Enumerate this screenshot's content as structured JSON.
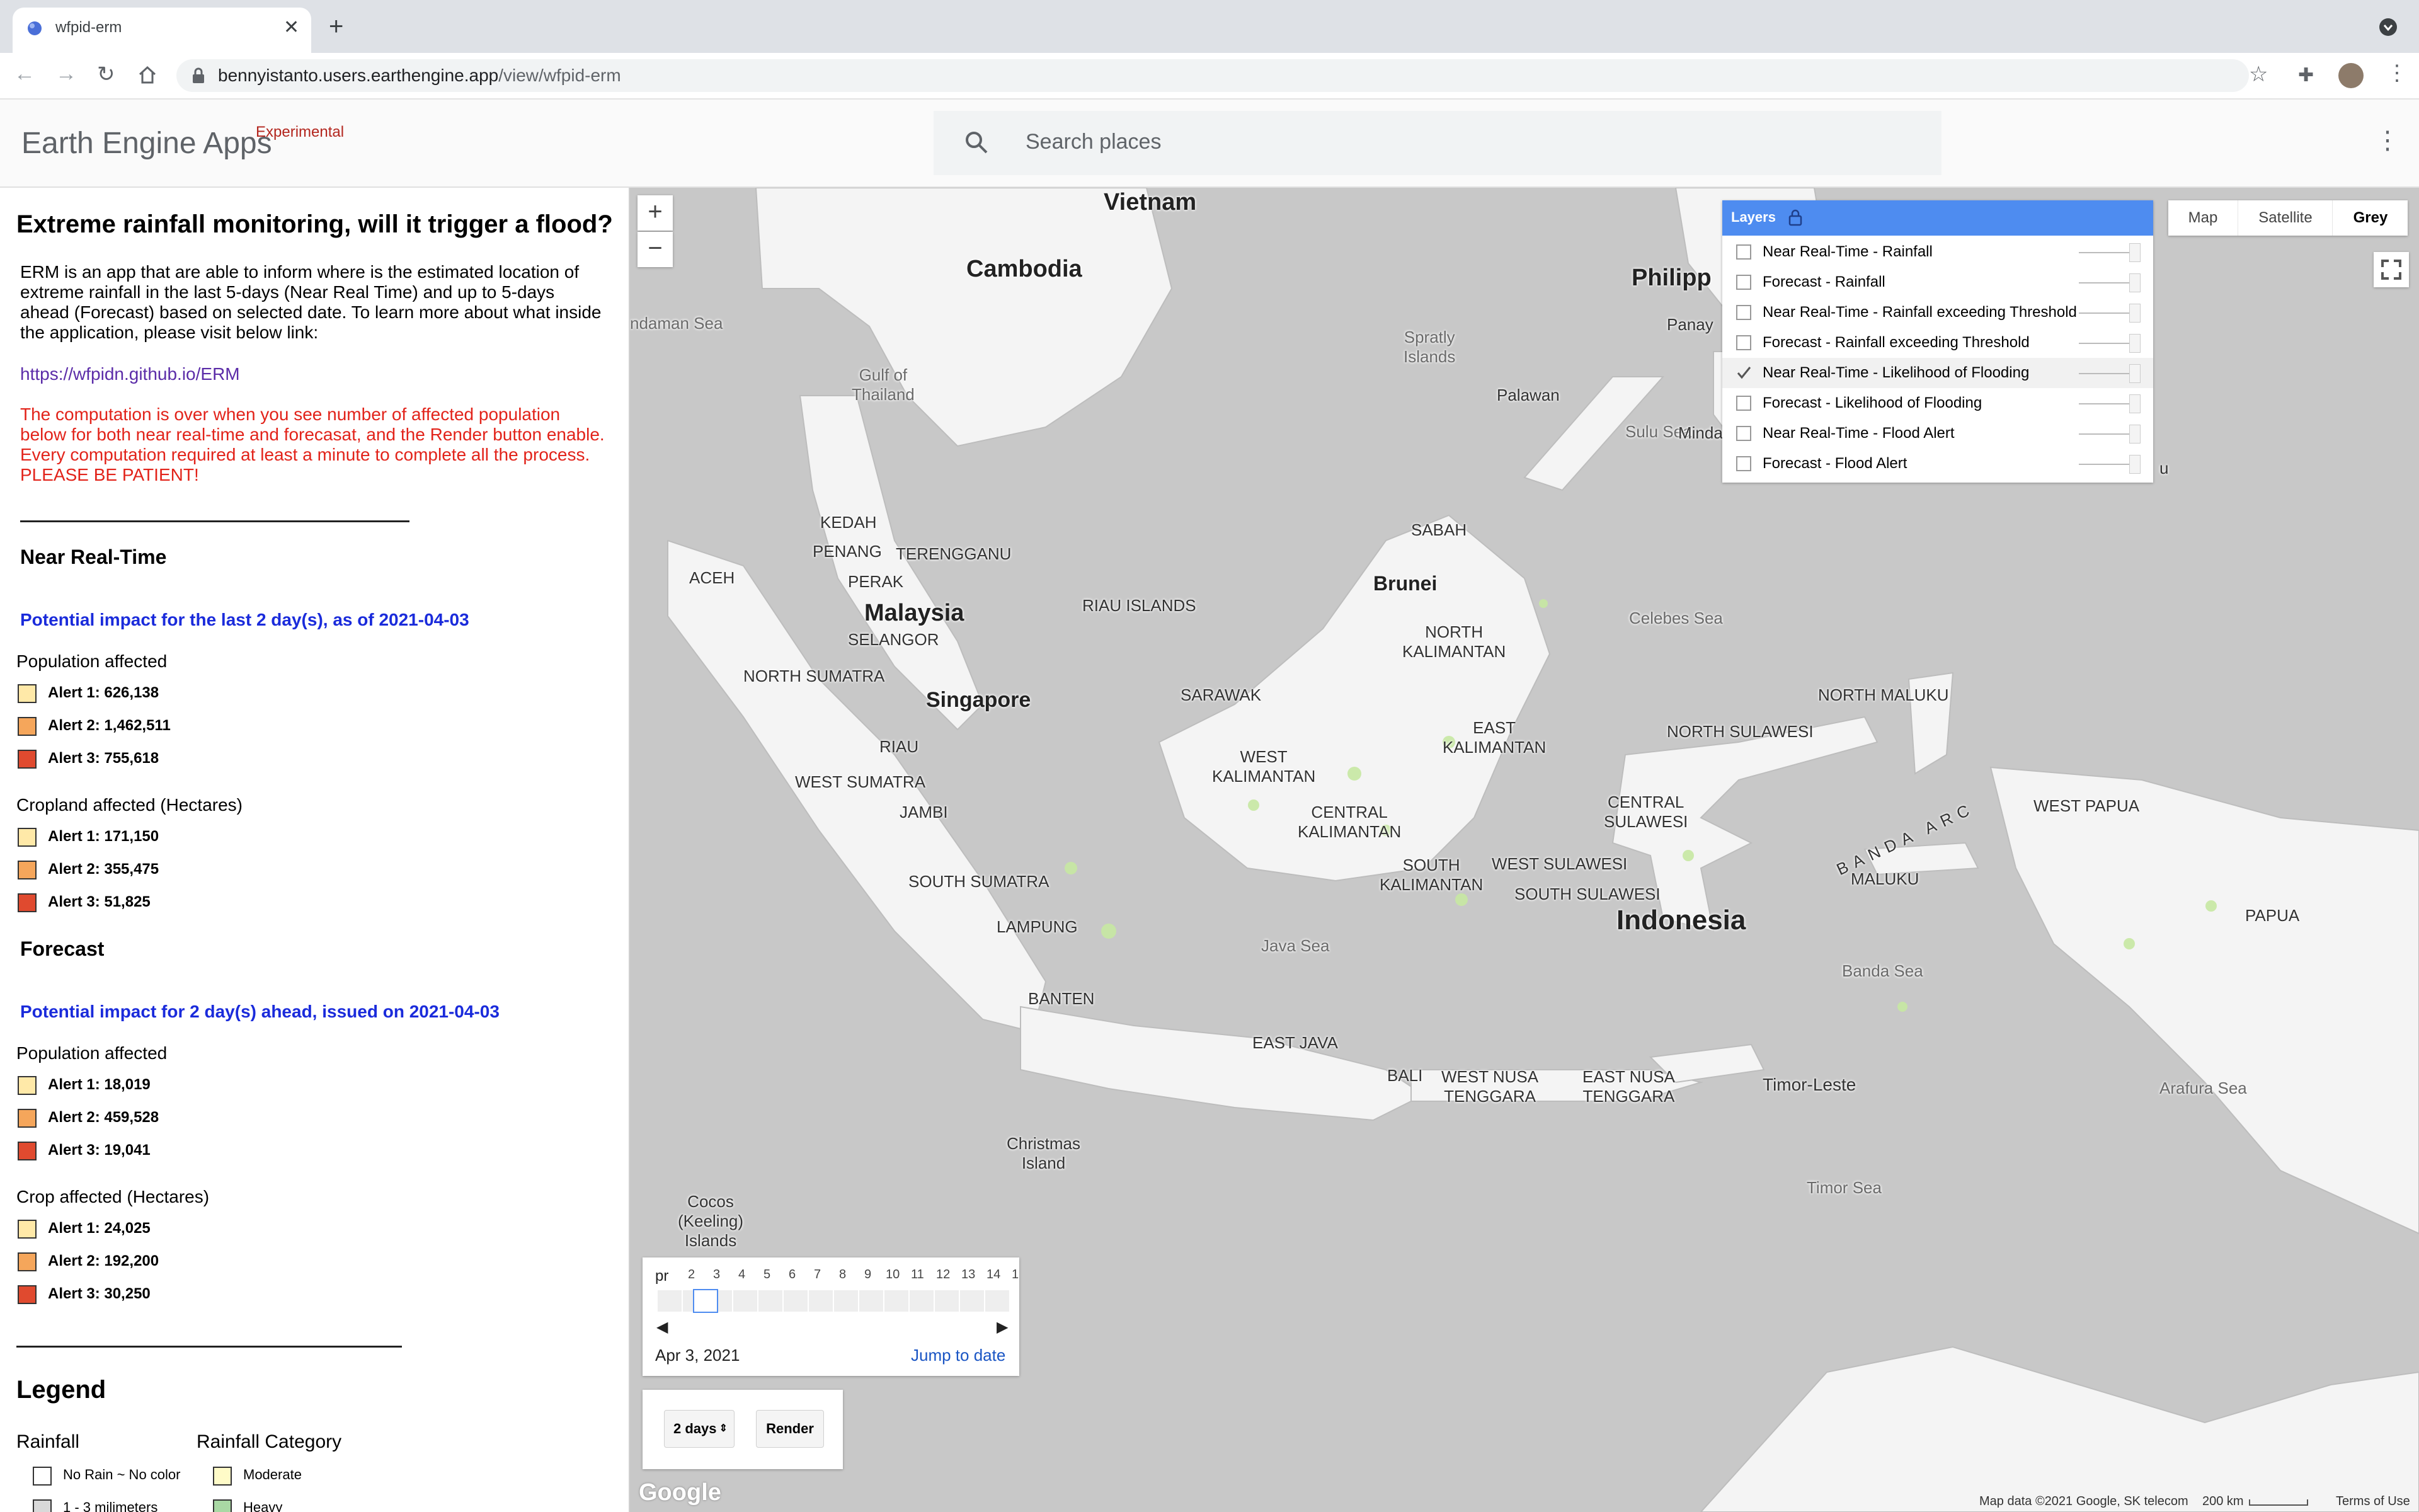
{
  "browser": {
    "tab_title": "wfpid-erm",
    "url_host": "bennyistanto.users.earthengine.app",
    "url_path": "/view/wfpid-erm"
  },
  "header": {
    "app_name": "Earth Engine Apps",
    "app_tag": "Experimental",
    "search_placeholder": "Search places"
  },
  "panel": {
    "title": "Extreme rainfall monitoring, will it trigger a flood?",
    "intro": "ERM is an app that are able to inform where is the estimated location of extreme rainfall in the last 5-days (Near Real Time) and up to 5-days ahead (Forecast) based on selected date. To learn more about what inside the application, please visit below link:",
    "link": "https://wfpidn.github.io/ERM",
    "warning": "The computation is over when you see number of affected population below for both near real-time and forecasat, and the Render button enable. Every computation required at least a minute to complete all the process. PLEASE BE PATIENT!",
    "nrt": {
      "heading": "Near Real-Time",
      "impact": "Potential impact for the last 2 day(s), as of 2021-04-03",
      "pop_label": "Population affected",
      "pop": [
        "Alert 1: 626,138",
        "Alert 2: 1,462,511",
        "Alert 3: 755,618"
      ],
      "crop_label": "Cropland affected (Hectares)",
      "crop": [
        "Alert 1: 171,150",
        "Alert 2: 355,475",
        "Alert 3: 51,825"
      ]
    },
    "fc": {
      "heading": "Forecast",
      "impact": "Potential impact for 2 day(s) ahead, issued on 2021-04-03",
      "pop_label": "Population affected",
      "pop": [
        "Alert 1: 18,019",
        "Alert 2: 459,528",
        "Alert 3: 19,041"
      ],
      "crop_label": "Crop affected (Hectares)",
      "crop": [
        "Alert 1: 24,025",
        "Alert 2: 192,200",
        "Alert 3: 30,250"
      ]
    },
    "legend": {
      "title": "Legend",
      "rainfall": "Rainfall",
      "category": "Rainfall Category",
      "items": [
        "No Rain ~ No color",
        "1 - 3 milimeters"
      ],
      "cat_items": [
        "Moderate",
        "Heavy"
      ]
    },
    "alert_colors": [
      "#ffe9a8",
      "#f5a65b",
      "#e04a2f"
    ]
  },
  "map": {
    "map_types": [
      "Map",
      "Satellite",
      "Grey"
    ],
    "selected_map_type": "Grey",
    "layers_title": "Layers",
    "layers": [
      {
        "label": "Near Real-Time - Rainfall",
        "checked": false
      },
      {
        "label": "Forecast - Rainfall",
        "checked": false
      },
      {
        "label": "Near Real-Time - Rainfall exceeding Threshold",
        "checked": false
      },
      {
        "label": "Forecast - Rainfall exceeding Threshold",
        "checked": false
      },
      {
        "label": "Near Real-Time - Likelihood of Flooding",
        "checked": true
      },
      {
        "label": "Forecast - Likelihood of Flooding",
        "checked": false
      },
      {
        "label": "Near Real-Time - Flood Alert",
        "checked": false
      },
      {
        "label": "Forecast - Flood Alert",
        "checked": false
      }
    ],
    "labels": {
      "vietnam": "Vietnam",
      "cambodia": "Cambodia",
      "philippines": "Philipp",
      "andaman": "ndaman Sea",
      "gulf_thailand": "Gulf of\nThailand",
      "spratly": "Spratly\nIslands",
      "panay": "Panay",
      "palawan": "Palawan",
      "sulu": "Sulu Sea",
      "minda": "Minda",
      "kedah": "KEDAH",
      "penang": "PENANG",
      "terengganu": "TERENGGANU",
      "perak": "PERAK",
      "aceh": "ACEH",
      "sabah": "SABAH",
      "brunei": "Brunei",
      "malaysia": "Malaysia",
      "selangor": "SELANGOR",
      "riau_islands": "RIAU ISLANDS",
      "north_kalimantan": "NORTH\nKALIMANTAN",
      "celebes": "Celebes Sea",
      "north_sumatra": "NORTH SUMATRA",
      "singapore": "Singapore",
      "sarawak": "SARAWAK",
      "north_maluku": "NORTH MALUKU",
      "riau": "RIAU",
      "east_kalimantan": "EAST\nKALIMANTAN",
      "north_sulawesi": "NORTH SULAWESI",
      "west_kalimantan": "WEST\nKALIMANTAN",
      "west_sumatra": "WEST SUMATRA",
      "jambi": "JAMBI",
      "central_kalimantan": "CENTRAL\nKALIMANTAN",
      "central_sulawesi": "CENTRAL\nSULAWESI",
      "west_papua": "WEST PAPUA",
      "banda_arc": "BANDA ARC",
      "south_kalimantan": "SOUTH\nKALIMANTAN",
      "west_sulawesi": "WEST SULAWESI",
      "south_sumatra": "SOUTH SUMATRA",
      "south_sulawesi": "SOUTH SULAWESI",
      "maluku": "MALUKU",
      "indonesia": "Indonesia",
      "papua": "PAPUA",
      "lampung": "LAMPUNG",
      "java_sea": "Java Sea",
      "banda_sea": "Banda Sea",
      "banten": "BANTEN",
      "east_java": "EAST JAVA",
      "bali": "BALI",
      "west_nusa": "WEST NUSA\nTENGGARA",
      "east_nusa": "EAST NUSA\nTENGGARA",
      "timor_leste": "Timor-Leste",
      "arafura": "Arafura Sea",
      "christmas": "Christmas\nIsland",
      "cocos": "Cocos\n(Keeling)\nIslands",
      "timor_sea": "Timor Sea",
      "u": "u"
    },
    "attribution": "Map data ©2021 Google, SK telecom",
    "scale": "200 km",
    "terms": "Terms of Use",
    "google": "Google"
  },
  "date_slider": {
    "ticks": [
      "pr",
      "2",
      "3",
      "4",
      "5",
      "6",
      "7",
      "8",
      "9",
      "10",
      "11",
      "12",
      "13",
      "14",
      "1"
    ],
    "date": "Apr 3, 2021",
    "jump": "Jump to date"
  },
  "render": {
    "days": "2 days",
    "button": "Render"
  }
}
